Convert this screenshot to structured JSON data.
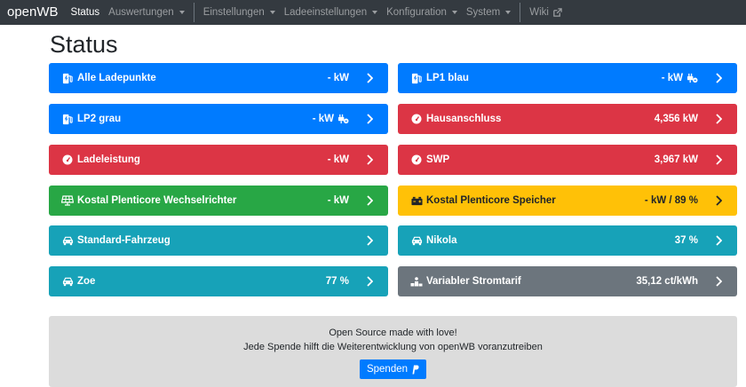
{
  "nav": {
    "brand": "openWB",
    "items": [
      {
        "label": "Status",
        "active": true,
        "caret": false
      },
      {
        "label": "Auswertungen",
        "caret": true
      },
      {
        "label": "Einstellungen",
        "caret": true
      },
      {
        "label": "Ladeeinstellungen",
        "caret": true
      },
      {
        "label": "Konfiguration",
        "caret": true
      },
      {
        "label": "System",
        "caret": true
      },
      {
        "label": "Wiki",
        "caret": false
      }
    ]
  },
  "page": {
    "title": "Status"
  },
  "cards": {
    "alle_ladepunkte": {
      "label": "Alle Ladepunkte",
      "value": "- kW"
    },
    "lp1": {
      "label": "LP1 blau",
      "value": "- kW"
    },
    "lp2": {
      "label": "LP2 grau",
      "value": "- kW"
    },
    "hausanschluss": {
      "label": "Hausanschluss",
      "value": "4,356 kW"
    },
    "ladeleistung": {
      "label": "Ladeleistung",
      "value": "- kW"
    },
    "swp": {
      "label": "SWP",
      "value": "3,967 kW"
    },
    "wechselrichter": {
      "label": "Kostal Plenticore Wechselrichter",
      "value": "- kW"
    },
    "speicher": {
      "label": "Kostal Plenticore Speicher",
      "value": "- kW / 89 %"
    },
    "standard_fahrzeug": {
      "label": "Standard-Fahrzeug",
      "value": ""
    },
    "nikola": {
      "label": "Nikola",
      "value": "37 %"
    },
    "zoe": {
      "label": "Zoe",
      "value": "77 %"
    },
    "stromtarif": {
      "label": "Variabler Stromtarif",
      "value": "35,12 ct/kWh"
    }
  },
  "colors": {
    "blue": "#007bff",
    "red": "#dc3545",
    "green": "#28a745",
    "yellow": "#ffc107",
    "teal": "#17a2b8",
    "gray": "#6c757d"
  },
  "footer": {
    "line1": "Open Source made with love!",
    "line2": "Jede Spende hilft die Weiterentwicklung von openWB voranzutreiben",
    "donate_label": "Spenden"
  }
}
